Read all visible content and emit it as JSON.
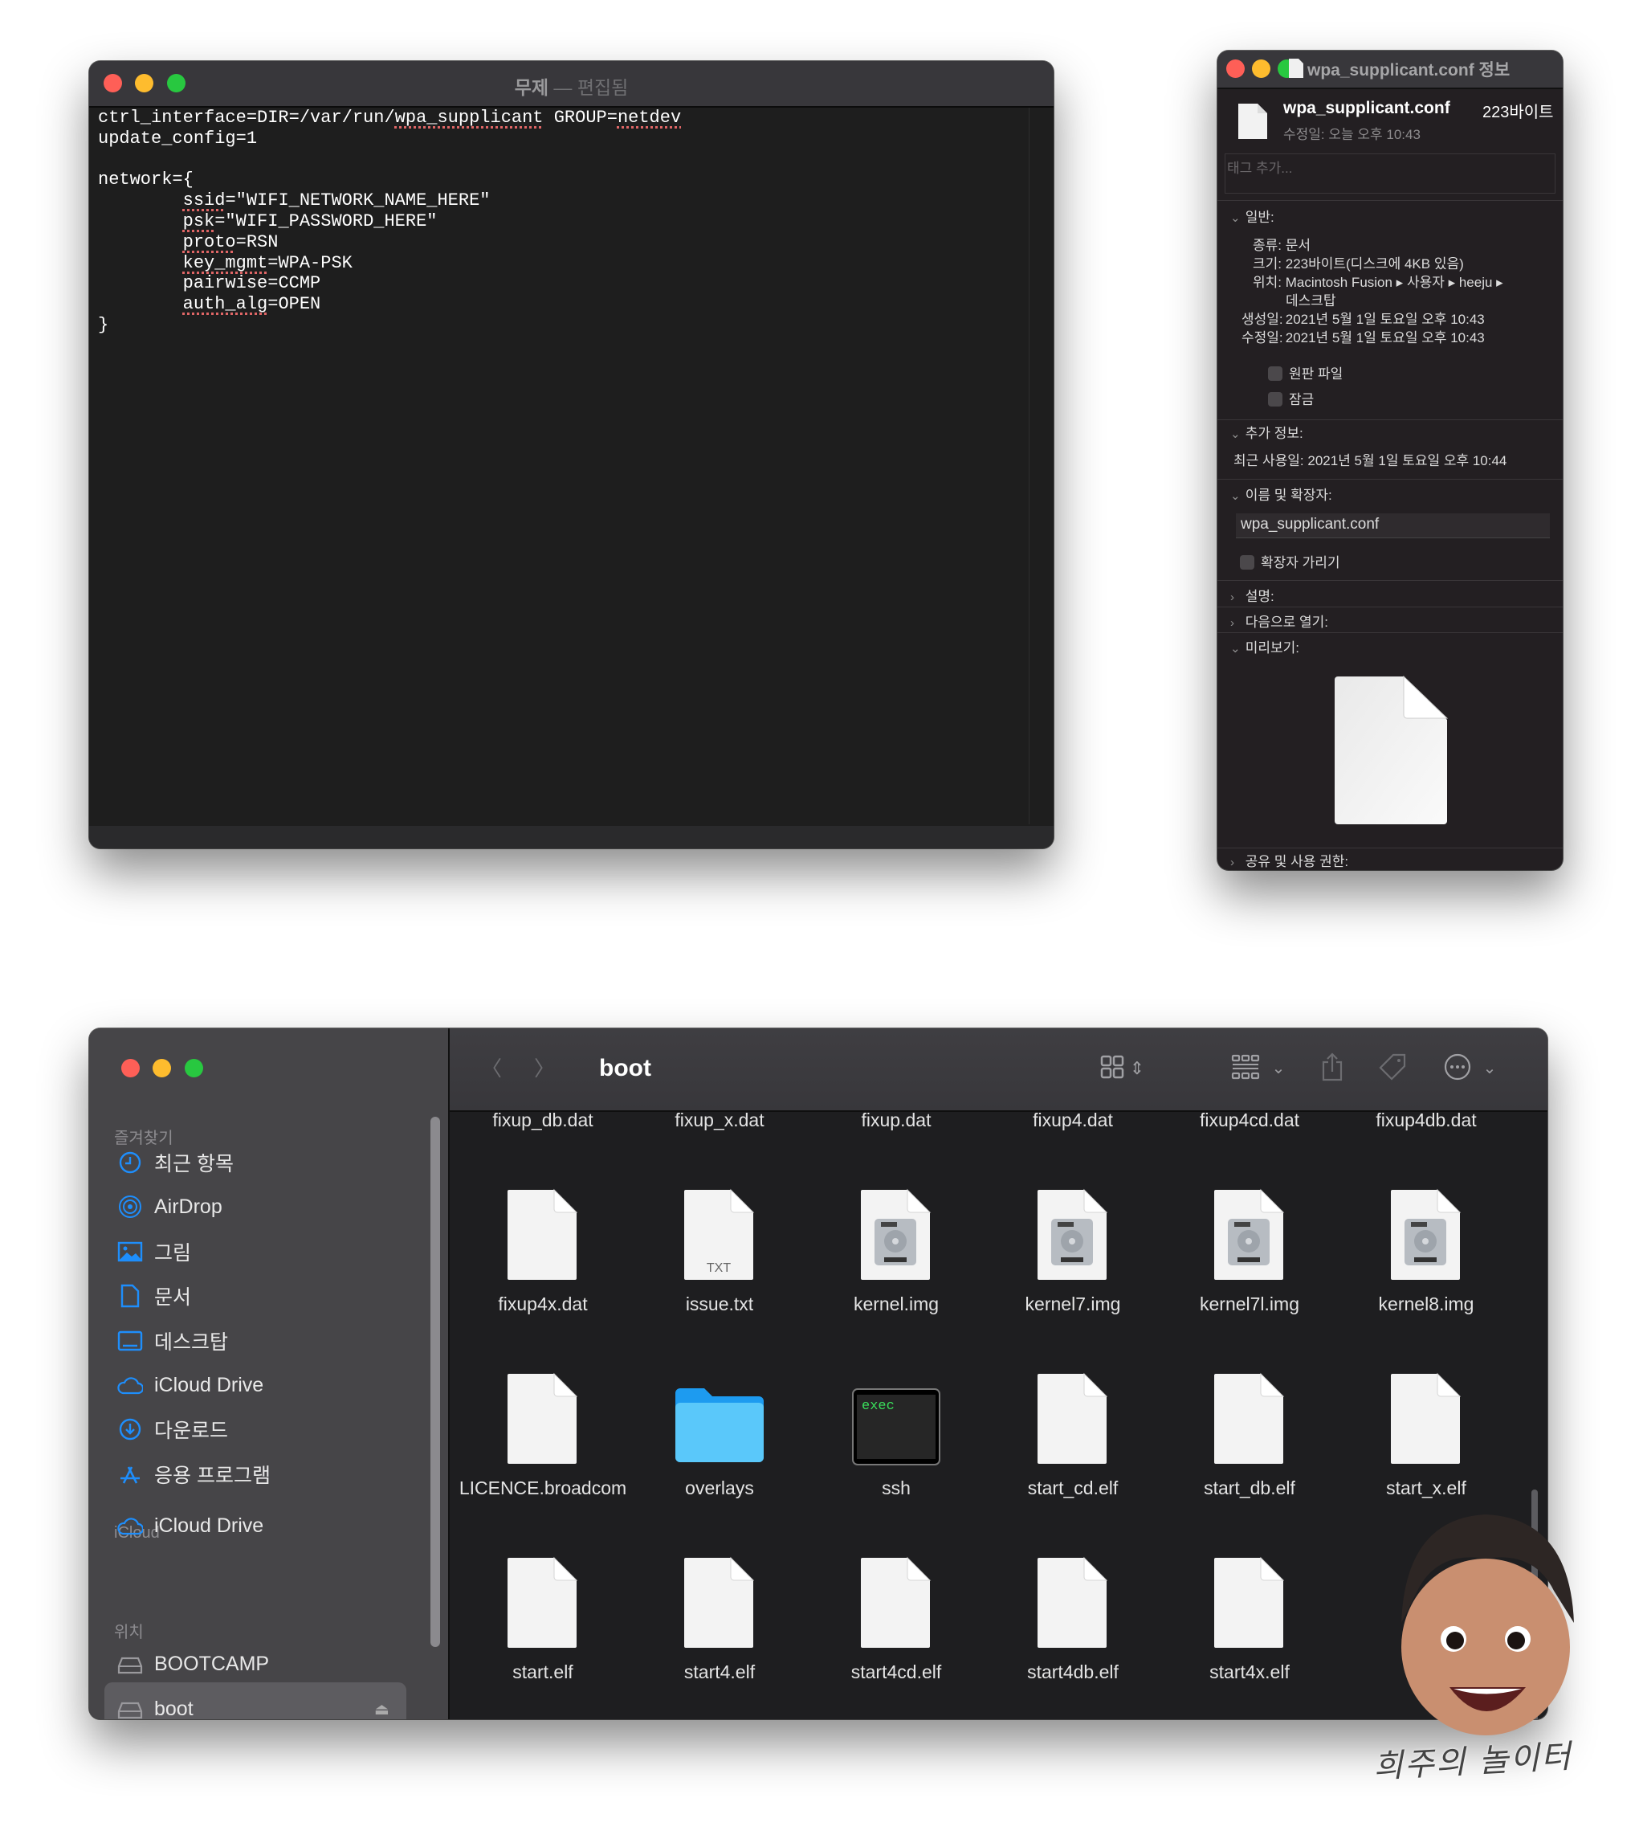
{
  "editor": {
    "title": "무제",
    "separator": "—",
    "subtitle": "편집됨",
    "lines": [
      "ctrl_interface=DIR=/var/run/wpa_supplicant GROUP=netdev",
      "update_config=1",
      "",
      "network={",
      "\tssid=\"WIFI_NETWORK_NAME_HERE\"",
      "\tpsk=\"WIFI_PASSWORD_HERE\"",
      "\tproto=RSN",
      "\tkey_mgmt=WPA-PSK",
      "\tpairwise=CCMP",
      "\tauth_alg=OPEN",
      "}"
    ],
    "spellcheck_flagged": [
      "wpa_supplicant",
      "netdev",
      "ssid",
      "psk",
      "proto",
      "key_mgmt",
      "auth_alg"
    ]
  },
  "info": {
    "window_title": "wpa_supplicant.conf 정보",
    "file_name": "wpa_supplicant.conf",
    "file_size": "223바이트",
    "modified_short": "수정일: 오늘 오후 10:43",
    "tags_placeholder": "태그 추가...",
    "general": {
      "header": "일반:",
      "kind_label": "종류:",
      "kind": "문서",
      "size_label": "크기:",
      "size": "223바이트(디스크에 4KB 있음)",
      "where_label": "위치:",
      "where": "Macintosh Fusion ▸ 사용자 ▸ heeju ▸",
      "where_cont": "데스크탑",
      "created_label": "생성일:",
      "created": "2021년 5월 1일 토요일 오후 10:43",
      "modified_label": "수정일:",
      "modified": "2021년 5월 1일 토요일 오후 10:43",
      "stationery": "원판 파일",
      "locked": "잠금"
    },
    "more_info": {
      "header": "추가 정보:",
      "last_opened": "최근 사용일: 2021년 5월 1일 토요일 오후 10:44"
    },
    "name_ext": {
      "header": "이름 및 확장자:",
      "value": "wpa_supplicant.conf",
      "hide_ext": "확장자 가리기"
    },
    "comments": "설명:",
    "open_with": "다음으로 열기:",
    "preview": "미리보기:",
    "sharing": "공유 및 사용 권한:"
  },
  "finder": {
    "title": "boot",
    "sidebar": {
      "favorites_header": "즐겨찾기",
      "favorites": [
        {
          "label": "최근 항목",
          "icon": "clock"
        },
        {
          "label": "AirDrop",
          "icon": "airdrop"
        },
        {
          "label": "그림",
          "icon": "photo"
        },
        {
          "label": "문서",
          "icon": "doc"
        },
        {
          "label": "데스크탑",
          "icon": "desktop"
        },
        {
          "label": "iCloud Drive",
          "icon": "cloud"
        },
        {
          "label": "다운로드",
          "icon": "download"
        },
        {
          "label": "응용 프로그램",
          "icon": "apps"
        }
      ],
      "icloud_header": "iCloud",
      "icloud": [
        {
          "label": "iCloud Drive",
          "icon": "cloud"
        }
      ],
      "locations_header": "위치",
      "locations": [
        {
          "label": "BOOTCAMP",
          "icon": "drive"
        },
        {
          "label": "boot",
          "icon": "drive",
          "selected": true
        }
      ]
    },
    "files": [
      {
        "name": "fixup_db.dat",
        "icon": "doc"
      },
      {
        "name": "fixup_x.dat",
        "icon": "doc"
      },
      {
        "name": "fixup.dat",
        "icon": "doc"
      },
      {
        "name": "fixup4.dat",
        "icon": "doc"
      },
      {
        "name": "fixup4cd.dat",
        "icon": "doc"
      },
      {
        "name": "fixup4db.dat",
        "icon": "doc"
      },
      {
        "name": "fixup4x.dat",
        "icon": "doc"
      },
      {
        "name": "issue.txt",
        "icon": "txt",
        "badge": "TXT"
      },
      {
        "name": "kernel.img",
        "icon": "disk"
      },
      {
        "name": "kernel7.img",
        "icon": "disk"
      },
      {
        "name": "kernel7l.img",
        "icon": "disk"
      },
      {
        "name": "kernel8.img",
        "icon": "disk"
      },
      {
        "name": "LICENCE.broadcom",
        "icon": "doc"
      },
      {
        "name": "overlays",
        "icon": "folder"
      },
      {
        "name": "ssh",
        "icon": "exec",
        "badge": "exec"
      },
      {
        "name": "start_cd.elf",
        "icon": "doc"
      },
      {
        "name": "start_db.elf",
        "icon": "doc"
      },
      {
        "name": "start_x.elf",
        "icon": "doc"
      },
      {
        "name": "start.elf",
        "icon": "doc"
      },
      {
        "name": "start4.elf",
        "icon": "doc"
      },
      {
        "name": "start4cd.elf",
        "icon": "doc"
      },
      {
        "name": "start4db.elf",
        "icon": "doc"
      },
      {
        "name": "start4x.elf",
        "icon": "doc"
      }
    ],
    "accent": "#1e8efc"
  },
  "watermark": "희주의 놀이터"
}
